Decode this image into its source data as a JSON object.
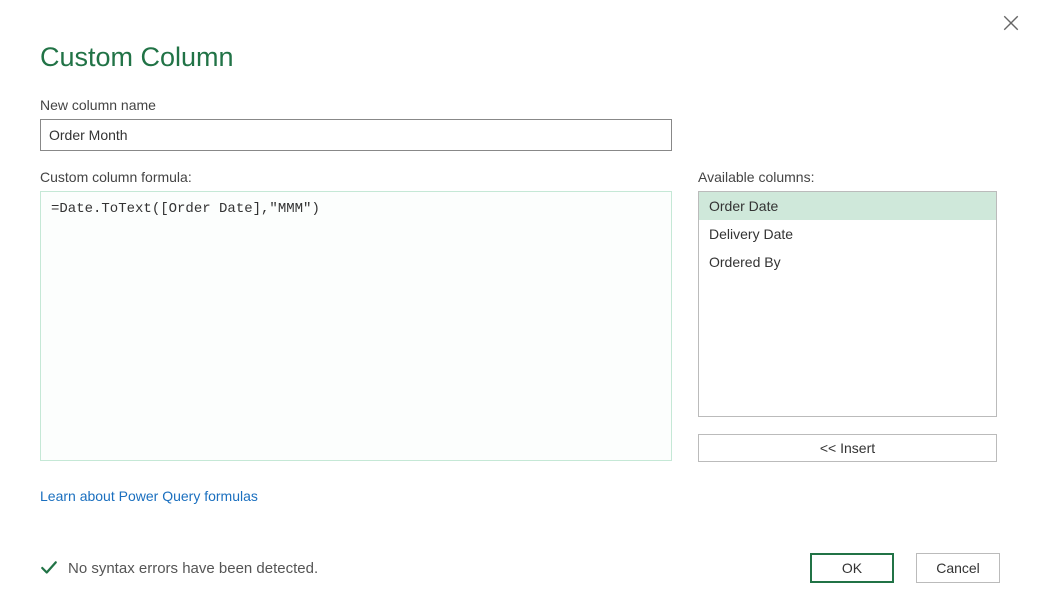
{
  "dialog": {
    "title": "Custom Column"
  },
  "column_name": {
    "label": "New column name",
    "value": "Order Month"
  },
  "formula": {
    "label": "Custom column formula:",
    "value": "=Date.ToText([Order Date],\"MMM\")"
  },
  "available_columns": {
    "label": "Available columns:",
    "items": [
      "Order Date",
      "Delivery Date",
      "Ordered By"
    ],
    "selected_index": 0
  },
  "insert_button": {
    "label": "<< Insert"
  },
  "learn_link": {
    "text": "Learn about Power Query formulas"
  },
  "status": {
    "text": "No syntax errors have been detected."
  },
  "buttons": {
    "ok": "OK",
    "cancel": "Cancel"
  }
}
